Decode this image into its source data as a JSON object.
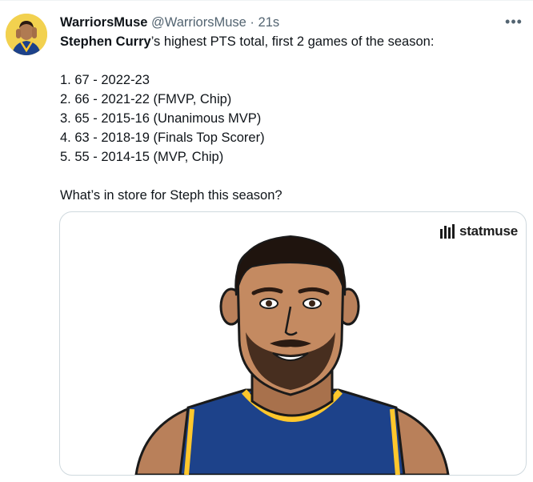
{
  "author": {
    "name": "WarriorsMuse",
    "handle": "@WarriorsMuse",
    "separator": "·",
    "time": "21s"
  },
  "more_icon": "more-horizontal-icon",
  "tweet": {
    "intro_bold": "Stephen Curry",
    "intro_rest": "’s highest PTS total, first 2 games of the season:",
    "items": [
      "1. 67 - 2022-23",
      "2. 66 - 2021-22 (FMVP, Chip)",
      "3. 65 - 2015-16 (Unanimous MVP)",
      "4. 63 - 2018-19 (Finals Top Scorer)",
      "5. 55 - 2014-15 (MVP, Chip)"
    ],
    "question": "What’s in store for Steph this season?"
  },
  "card": {
    "brand": "statmuse",
    "brand_icon": "statmuse-logo-icon"
  },
  "colors": {
    "text": "#0f1419",
    "muted": "#536471",
    "border": "#cfd9de",
    "jersey_blue": "#1d428a",
    "jersey_gold": "#ffc72c"
  }
}
